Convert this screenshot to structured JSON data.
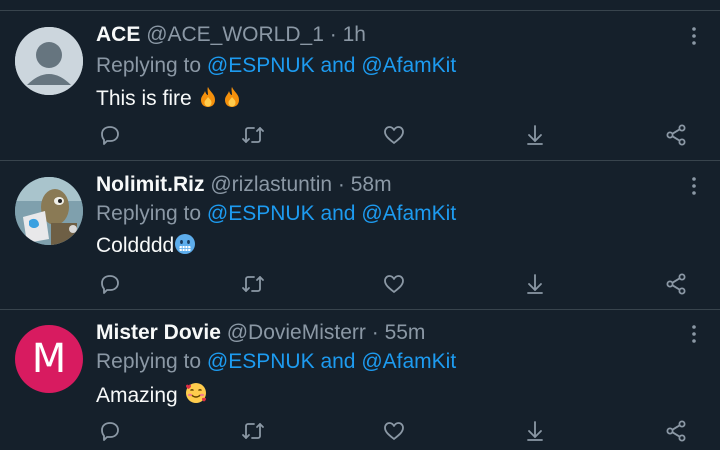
{
  "tweets": [
    {
      "display_name": "ACE",
      "handle": "@ACE_WORLD_1",
      "separator": "·",
      "time": "1h",
      "reply_prefix": "Replying to",
      "mention_1": "@ESPNUK",
      "reply_and": "and",
      "mention_2": "@AfamKit",
      "text": "This is fire",
      "emojis": [
        "fire-emoji",
        "fire-emoji"
      ],
      "avatar": "default-avatar"
    },
    {
      "display_name": "Nolimit.Riz",
      "handle": "@rizlastuntin",
      "separator": "·",
      "time": "58m",
      "reply_prefix": "Replying to",
      "mention_1": "@ESPNUK",
      "reply_and": "and",
      "mention_2": "@AfamKit",
      "text": "Coldddd",
      "emojis": [
        "cold-face-emoji"
      ],
      "avatar": "cartoon-avatar"
    },
    {
      "display_name": "Mister Dovie",
      "handle": "@DovieMisterr",
      "separator": "·",
      "time": "55m",
      "reply_prefix": "Replying to",
      "mention_1": "@ESPNUK",
      "reply_and": "and",
      "mention_2": "@AfamKit",
      "text": "Amazing",
      "emojis": [
        "smiling-face-with-hearts-emoji"
      ],
      "avatar": "letter-avatar",
      "avatar_letter": "M"
    }
  ],
  "colors": {
    "background": "#15202b",
    "divider": "#38444d",
    "primary_text": "#f7f9f9",
    "secondary_text": "#8b98a5",
    "mention": "#1d9bf0",
    "avatar_letter_bg": "#d81b60"
  },
  "actions": [
    "reply-icon",
    "retweet-icon",
    "like-icon",
    "download-icon",
    "share-icon"
  ]
}
